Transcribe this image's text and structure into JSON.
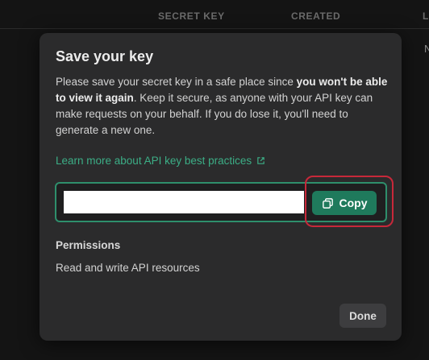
{
  "background": {
    "columns": [
      "SECRET KEY",
      "CREATED",
      "L"
    ],
    "partial_cell": "N"
  },
  "modal": {
    "title": "Save your key",
    "description": {
      "part1": "Please save your secret key in a safe place since ",
      "bold": "you won't be able to view it again",
      "part2": ". Keep it secure, as anyone with your API key can make requests on your behalf. If you do lose it, you'll need to generate a new one."
    },
    "learn_link": "Learn more about API key best practices",
    "key_value": "",
    "copy_label": "Copy",
    "permissions_label": "Permissions",
    "permissions_value": "Read and write API resources",
    "done_label": "Done"
  },
  "colors": {
    "accent": "#1f7a5c",
    "link": "#3cae86",
    "highlight": "#c8283a"
  },
  "icons": [
    "external-link-icon",
    "copy-icon"
  ]
}
